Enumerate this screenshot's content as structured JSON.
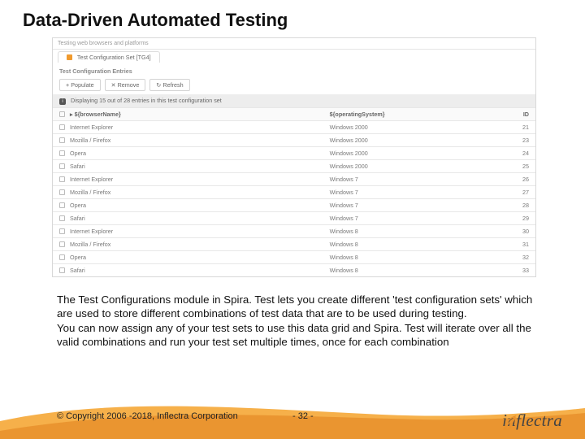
{
  "title": "Data-Driven Automated Testing",
  "screenshot": {
    "breadcrumb": "Testing web browsers and platforms",
    "tab": "Test Configuration Set [TG4]",
    "subheading": "Test Configuration Entries",
    "buttons": {
      "populate": "+ Populate",
      "remove": "✕ Remove",
      "refresh": "↻ Refresh"
    },
    "info": "Displaying 15 out of 28 entries in this test configuration set",
    "columns": {
      "browser": "${browserName}",
      "os": "${operatingSystem}",
      "id": "ID"
    },
    "rows": [
      {
        "browser": "Internet Explorer",
        "os": "Windows 2000",
        "id": "21"
      },
      {
        "browser": "Mozilla / Firefox",
        "os": "Windows 2000",
        "id": "23"
      },
      {
        "browser": "Opera",
        "os": "Windows 2000",
        "id": "24"
      },
      {
        "browser": "Safari",
        "os": "Windows 2000",
        "id": "25"
      },
      {
        "browser": "Internet Explorer",
        "os": "Windows 7",
        "id": "26"
      },
      {
        "browser": "Mozilla / Firefox",
        "os": "Windows 7",
        "id": "27"
      },
      {
        "browser": "Opera",
        "os": "Windows 7",
        "id": "28"
      },
      {
        "browser": "Safari",
        "os": "Windows 7",
        "id": "29"
      },
      {
        "browser": "Internet Explorer",
        "os": "Windows 8",
        "id": "30"
      },
      {
        "browser": "Mozilla / Firefox",
        "os": "Windows 8",
        "id": "31"
      },
      {
        "browser": "Opera",
        "os": "Windows 8",
        "id": "32"
      },
      {
        "browser": "Safari",
        "os": "Windows 8",
        "id": "33"
      }
    ]
  },
  "body": {
    "p1": "The Test Configurations module in Spira. Test lets you create different 'test configuration sets' which are used to store different combinations of test data that are to be used during testing.",
    "p2": "You can now assign any of your test sets to use this data grid and Spira. Test will iterate over all the valid combinations and run your test set multiple times, once for each combination"
  },
  "footer": {
    "copyright": "© Copyright 2006 -2018, Inflectra Corporation",
    "page": "- 32 -",
    "logo": "inflectra"
  }
}
